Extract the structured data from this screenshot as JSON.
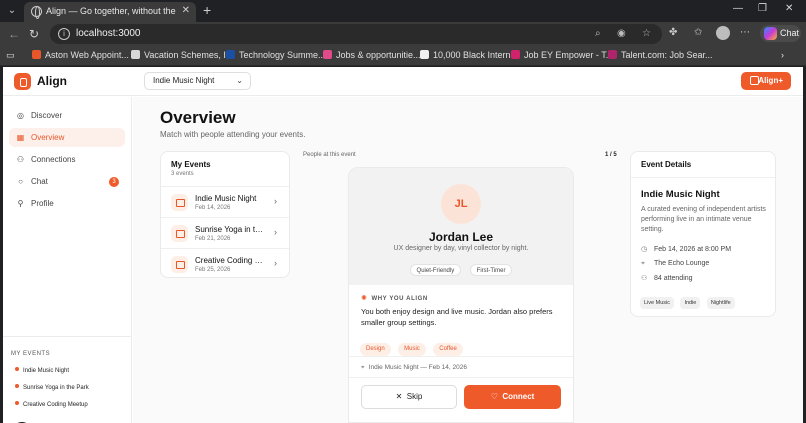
{
  "browser": {
    "tab_title": "Align — Go together, without the",
    "url": "localhost:3000",
    "chat_label": "Chat",
    "bookmarks": [
      {
        "label": "Aston Web Appoint...",
        "color": "#e8562a"
      },
      {
        "label": "Vacation Schemes, I...",
        "color": "#d9d9d9"
      },
      {
        "label": "Technology Summe...",
        "color": "#1a4fa3"
      },
      {
        "label": "Jobs & opportunitie...",
        "color": "#e14b8a"
      },
      {
        "label": "10,000 Black Interns",
        "color": "#f2f2f2"
      },
      {
        "label": "Job EY Empower - T...",
        "color": "#d1226c"
      },
      {
        "label": "Talent.com: Job Sear...",
        "color": "#b0246b"
      }
    ]
  },
  "app": {
    "brand": "Align",
    "accent": "#ef5a2a",
    "selected_event": "Indie Music Night",
    "upgrade_label": "Align+",
    "nav": [
      {
        "label": "Discover",
        "icon": "compass-icon",
        "active": false
      },
      {
        "label": "Overview",
        "icon": "grid-icon",
        "active": true
      },
      {
        "label": "Connections",
        "icon": "users-icon",
        "active": false
      },
      {
        "label": "Chat",
        "icon": "chat-bubble-icon",
        "active": false,
        "badge": "3"
      },
      {
        "label": "Profile",
        "icon": "user-icon",
        "active": false
      }
    ],
    "sidebar_events_heading": "MY EVENTS",
    "sidebar_events": [
      "Indie Music Night",
      "Sunrise Yoga in the Park",
      "Creative Coding Meetup"
    ],
    "next_badge": "N"
  },
  "main": {
    "title": "Overview",
    "subtitle": "Match with people attending your events.",
    "my_events": {
      "heading": "My Events",
      "count": "3 events",
      "items": [
        {
          "name": "Indie Music Night",
          "date": "Feb 14, 2026"
        },
        {
          "name": "Sunrise Yoga in the Park",
          "date": "Feb 21, 2026"
        },
        {
          "name": "Creative Coding Meetup",
          "date": "Feb 25, 2026"
        }
      ]
    },
    "people": {
      "label": "People at this event",
      "position": "1 / 5",
      "person": {
        "initials": "JL",
        "name": "Jordan Lee",
        "bio": "UX designer by day, vinyl collector by night.",
        "tags": [
          "Quiet-Friendly",
          "First-Timer"
        ]
      },
      "why_heading": "WHY YOU ALIGN",
      "why_text": "You both enjoy design and live music. Jordan also prefers smaller group settings.",
      "interests": [
        "Design",
        "Music",
        "Coffee"
      ],
      "event_line": "Indie Music Night — Feb 14, 2026",
      "skip_label": "Skip",
      "connect_label": "Connect"
    },
    "details": {
      "heading": "Event Details",
      "title": "Indie Music Night",
      "description": "A curated evening of independent artists performing live in an intimate venue setting.",
      "datetime": "Feb 14, 2026 at 8:00 PM",
      "venue": "The Echo Lounge",
      "attending": "84 attending",
      "tags": [
        "Live Music",
        "Indie",
        "Nightlife"
      ]
    }
  }
}
